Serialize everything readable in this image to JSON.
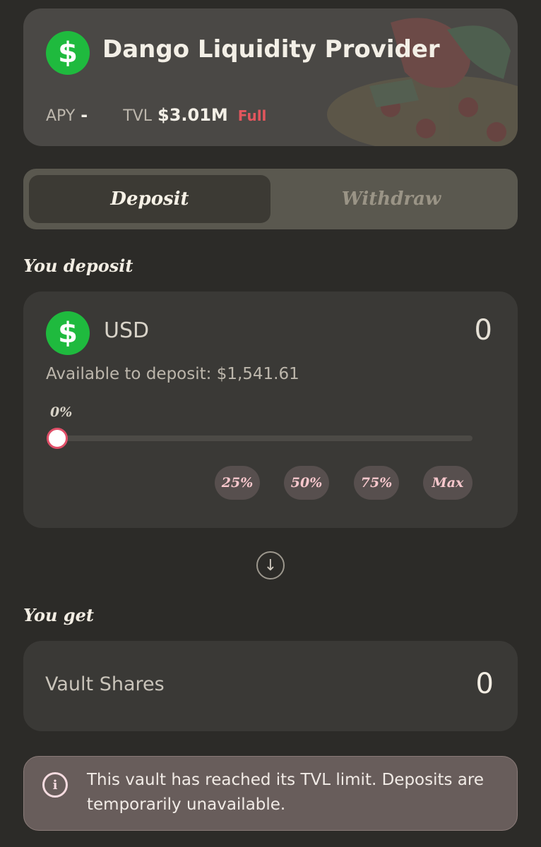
{
  "vault": {
    "icon": "dollar-icon",
    "name": "Dango Liquidity Provider",
    "apy_label": "APY",
    "apy_value": "-",
    "tvl_label": "TVL",
    "tvl_value": "$3.01M",
    "status": "Full"
  },
  "tabs": [
    {
      "label": "Deposit",
      "active": true
    },
    {
      "label": "Withdraw",
      "active": false
    }
  ],
  "deposit": {
    "section_label": "You deposit",
    "asset": "USD",
    "amount": "0",
    "available_text": "Available to deposit: $1,541.61",
    "slider_percent": "0%",
    "slider_value": 0,
    "quick_buttons": [
      "25%",
      "50%",
      "75%",
      "Max"
    ]
  },
  "get": {
    "section_label": "You get",
    "label": "Vault Shares",
    "value": "0"
  },
  "alert": {
    "message": "This vault has reached its TVL limit. Deposits are temporarily unavailable."
  },
  "colors": {
    "background": "#2c2b28",
    "accent_green": "#1fba3e",
    "full_red": "#e2565d",
    "slider_thumb_border": "#e04f68",
    "quick_button_text": "#f7c7cc"
  }
}
